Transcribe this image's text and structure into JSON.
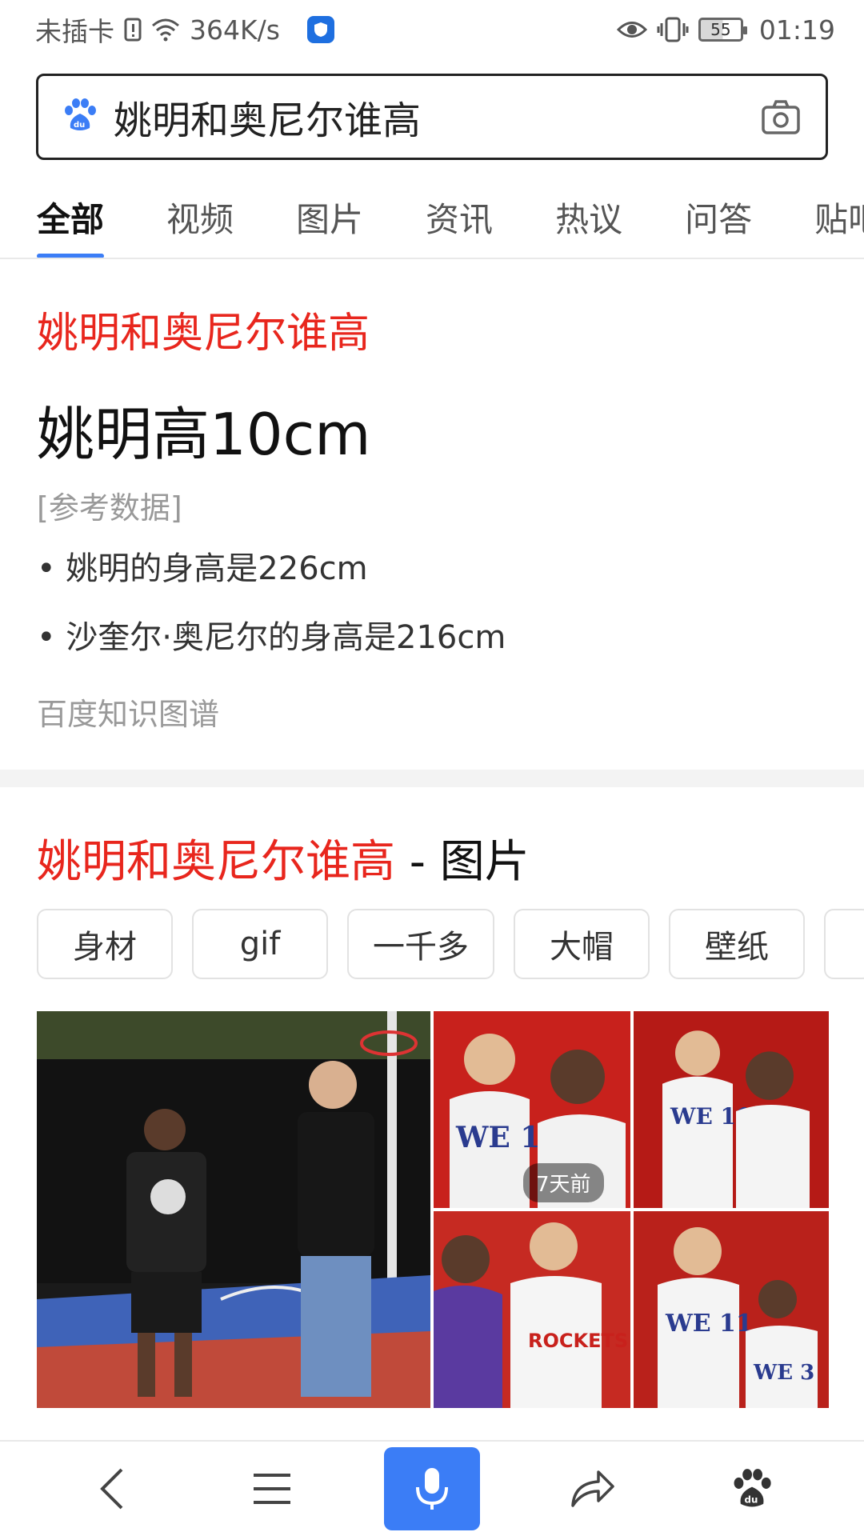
{
  "status_bar": {
    "carrier": "未插卡",
    "speed": "364K/s",
    "battery": "55",
    "time": "01:19"
  },
  "search": {
    "query": "姚明和奥尼尔谁高"
  },
  "tabs": [
    {
      "label": "全部",
      "active": true
    },
    {
      "label": "视频"
    },
    {
      "label": "图片"
    },
    {
      "label": "资讯"
    },
    {
      "label": "热议"
    },
    {
      "label": "问答"
    },
    {
      "label": "贴吧"
    }
  ],
  "answer": {
    "title": "姚明和奥尼尔谁高",
    "main": "姚明高10cm",
    "ref_label": "[参考数据]",
    "bullet1": "• 姚明的身高是226cm",
    "bullet2": "• 沙奎尔·奥尼尔的身高是216cm",
    "source": "百度知识图谱"
  },
  "images": {
    "title": "姚明和奥尼尔谁高",
    "title_suffix": " - 图片",
    "chips": [
      "身材",
      "gif",
      "一千多",
      "大帽",
      "壁纸"
    ],
    "badge": "7天前"
  },
  "colors": {
    "accent": "#3b7df6",
    "highlight_red": "#e8261d"
  }
}
